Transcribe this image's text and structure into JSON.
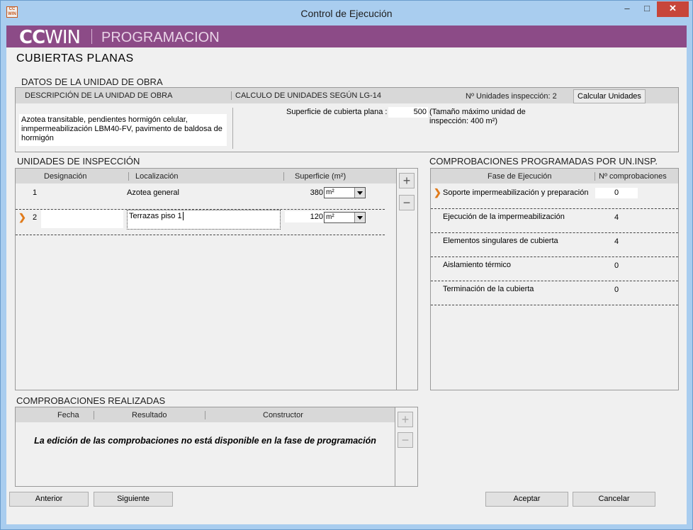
{
  "window": {
    "title": "Control de Ejecución",
    "icon_text": "CC WIN",
    "min": "–",
    "max": "□",
    "close": "✕"
  },
  "banner": {
    "logo_a": "CC",
    "logo_b": "WIN",
    "title": "PROGRAMACION"
  },
  "page_title": "CUBIERTAS PLANAS",
  "datos": {
    "section": "DATOS DE LA UNIDAD DE OBRA",
    "desc_header": "DESCRIPCIÓN DE LA UNIDAD DE OBRA",
    "calc_header": "CALCULO DE UNIDADES SEGÚN LG-14",
    "n_unidades": "Nº Unidades inspección: 2",
    "calc_button": "Calcular Unidades",
    "description": "Azotea transitable, pendientes hormigón celular, inmpermeabilización LBM40-FV, pavimento de baldosa de hormigón",
    "superficie_label": "Superficie de cubierta plana :",
    "superficie_value": "500",
    "superficie_note": "(Tamaño máximo unidad de inspección: 400 m²)"
  },
  "unidades": {
    "section": "UNIDADES DE INSPECCIÓN",
    "columns": [
      "Designación",
      "Localización",
      "Superficie (m²)"
    ],
    "rows": [
      {
        "designacion": "1",
        "localizacion": "Azotea general",
        "superficie": "380",
        "unidad": "m²"
      },
      {
        "designacion": "2",
        "localizacion": "Terrazas piso 1",
        "superficie": "120",
        "unidad": "m²"
      }
    ],
    "add": "+",
    "remove": "−"
  },
  "comprobaciones_prog": {
    "section": "COMPROBACIONES PROGRAMADAS POR UN.INSP.",
    "columns": [
      "Fase de Ejecución",
      "Nº comprobaciones"
    ],
    "rows": [
      {
        "fase": "Soporte impermeabilización y preparación",
        "n": "0"
      },
      {
        "fase": "Ejecución de la impermeabilización",
        "n": "4"
      },
      {
        "fase": "Elementos singulares de cubierta",
        "n": "4"
      },
      {
        "fase": "Aislamiento térmico",
        "n": "0"
      },
      {
        "fase": "Terminación de la cubierta",
        "n": "0"
      }
    ]
  },
  "realizadas": {
    "section": "COMPROBACIONES REALIZADAS",
    "columns": [
      "Fecha",
      "Resultado",
      "Constructor"
    ],
    "message": "La edición de las comprobaciones no está disponible en la fase de programación",
    "add": "+",
    "remove": "−"
  },
  "footer": {
    "anterior": "Anterior",
    "siguiente": "Siguiente",
    "aceptar": "Aceptar",
    "cancelar": "Cancelar"
  },
  "colors": {
    "banner": "#8c4b87",
    "titlebar": "#a9cdef",
    "close": "#c7463a",
    "accent": "#e07a1a"
  }
}
